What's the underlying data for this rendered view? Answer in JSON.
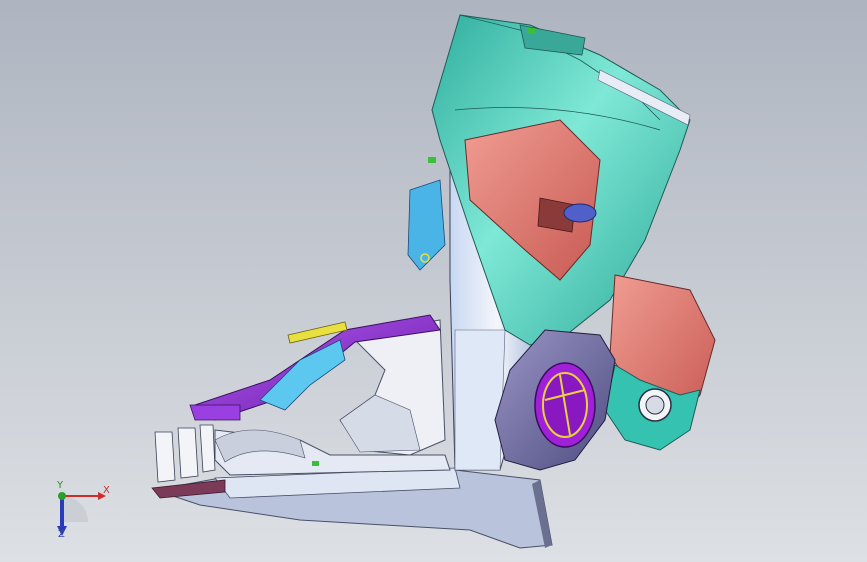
{
  "viewport": {
    "background_top": "#aeb4c0",
    "background_bottom": "#dde0e4"
  },
  "model": {
    "part_colors": {
      "teal_shell": "#3fc9b6",
      "salmon_panel": "#e07a72",
      "white_body": "#e8ecf4",
      "purple_bracket": "#8a2fd0",
      "cyan_bracket": "#4ab4e6",
      "yellow_strip": "#e8e040",
      "green_marker": "#38c038"
    }
  },
  "triad": {
    "x_label": "X",
    "y_label": "Y",
    "z_label": "Z",
    "x_color": "#d02a2a",
    "y_color": "#2aa02a",
    "z_color": "#2a3ab8"
  }
}
